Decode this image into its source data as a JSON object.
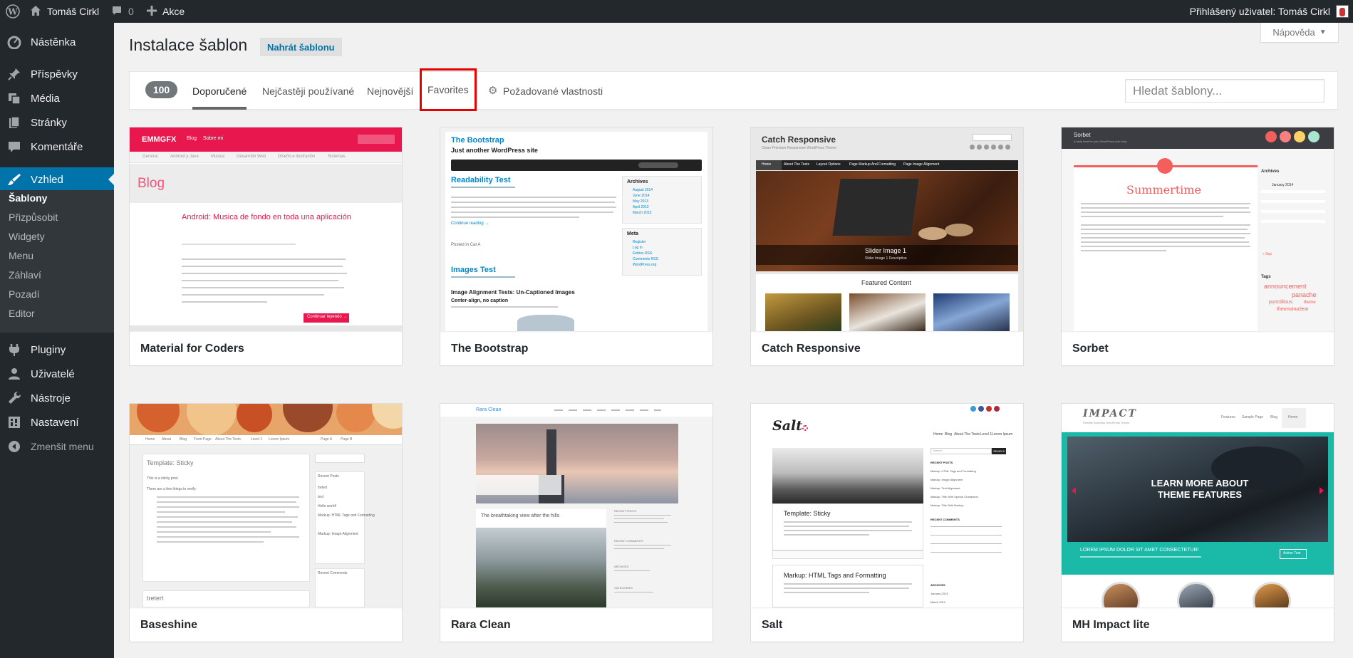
{
  "adminbar": {
    "site_name": "Tomáš Cirkl",
    "comments_count": "0",
    "new_label": "Akce",
    "account_label": "Přihlášený uživatel: Tomáš Cirkl"
  },
  "sidebar": {
    "items": [
      {
        "label": "Nástěnka",
        "icon": "dashboard-icon"
      },
      {
        "label": "Příspěvky",
        "icon": "pin-icon"
      },
      {
        "label": "Média",
        "icon": "media-icon"
      },
      {
        "label": "Stránky",
        "icon": "pages-icon"
      },
      {
        "label": "Komentáře",
        "icon": "comment-icon"
      },
      {
        "label": "Vzhled",
        "icon": "brush-icon"
      },
      {
        "label": "Pluginy",
        "icon": "plugin-icon"
      },
      {
        "label": "Uživatelé",
        "icon": "users-icon"
      },
      {
        "label": "Nástroje",
        "icon": "wrench-icon"
      },
      {
        "label": "Nastavení",
        "icon": "settings-icon"
      }
    ],
    "submenu": [
      "Šablony",
      "Přizpůsobit",
      "Widgety",
      "Menu",
      "Záhlaví",
      "Pozadí",
      "Editor"
    ],
    "collapse_label": "Zmenšit menu"
  },
  "header": {
    "title": "Instalace šablon",
    "upload_label": "Nahrát šablonu",
    "help_label": "Nápověda"
  },
  "filters": {
    "count": "100",
    "tabs": [
      "Doporučené",
      "Nejčastěji používané",
      "Nejnovější",
      "Favorites"
    ],
    "feature_filter": "Požadované vlastnosti",
    "search_placeholder": "Hledat šablony..."
  },
  "themes": [
    {
      "name": "Material for Coders",
      "preview": {
        "logo": "EMMGFX",
        "nav": [
          "Blog",
          "Sobre mi"
        ],
        "cats": [
          "General",
          "Android y Java",
          "Musica",
          "Desarrollo Web",
          "Diseño e ilustración",
          "Sistemas"
        ],
        "heading": "Blog",
        "post_title": "Android: Musica de fondo en toda una aplicación",
        "button": "Continuar leyendo →"
      }
    },
    {
      "name": "The Bootstrap",
      "preview": {
        "site_title": "The Bootstrap",
        "tagline": "Just another WordPress site",
        "post1": "Readability Test",
        "post2": "Images Test",
        "post3": "Image Alignment Tests: Un-Captioned Images",
        "post3_sub": "Center-align, no caption",
        "widget1": "Archives",
        "widget2": "Meta",
        "archives": [
          "August 2014",
          "June 2014",
          "May 2013",
          "April 2013",
          "March 2013"
        ],
        "meta": [
          "Register",
          "Log in",
          "Entries RSS",
          "Comments RSS",
          "WordPress.org"
        ],
        "more": "Continue reading →",
        "posted": "Posted in Cat A"
      }
    },
    {
      "name": "Catch Responsive",
      "preview": {
        "site_title": "Catch Responsive",
        "tagline": "Clean Premium Responsive WordPress Theme",
        "nav": [
          "Home",
          "About The Tests",
          "Layout Options",
          "Page Markup And Formatting",
          "Page Image Alignment"
        ],
        "slider_title": "Slider Image 1",
        "slider_sub": "Slider Image 1 Description",
        "featured": "Featured Content"
      }
    },
    {
      "name": "Sorbet",
      "preview": {
        "site_title": "Sorbet",
        "tagline": "A tasty treat for your WordPress.com blog",
        "post_title": "Summertime",
        "archives": "Archives",
        "calendar": "January 2014",
        "tags_title": "Tags",
        "tags": [
          "announcement",
          "panache",
          "punctilious",
          "theme",
          "thermonuclear"
        ],
        "prev": "« Sep"
      }
    },
    {
      "name": "Baseshine",
      "preview": {
        "nav": [
          "Home",
          "About",
          "Blog",
          "Front Page",
          "About The Tests",
          "Level 1",
          "Lorem Ipsum",
          "Page A",
          "Page B"
        ],
        "post_title": "Template: Sticky",
        "recent": "Recent Posts",
        "recent_items": [
          "tretert",
          "test",
          "Hello world!",
          "Markup: HTML Tags and Formatting",
          "Markup: Image Alignment"
        ],
        "comments": "Recent Comments",
        "post2": "tretert",
        "intro": [
          "This is a sticky post.",
          "There are a few things to verify:"
        ]
      }
    },
    {
      "name": "Rara Clean",
      "preview": {
        "site_title": "Rara Clean",
        "post_title": "The breathtaking view after the hills",
        "widgets": [
          "RECENT POSTS",
          "RECENT COMMENTS",
          "ARCHIVES",
          "CATEGORIES"
        ]
      }
    },
    {
      "name": "Salt",
      "preview": {
        "site_title": "Salt",
        "nav": [
          "Home",
          "Blog",
          "About The Tests",
          "Level 1",
          "Lorem Ipsum"
        ],
        "post_title": "Template: Sticky",
        "post2": "Markup: HTML Tags and Formatting",
        "search": "Search ...",
        "search_btn": "SEARCH",
        "widgets": [
          "RECENT POSTS",
          "RECENT COMMENTS",
          "ARCHIVES"
        ],
        "recent": [
          "Markup: HTML Tags and Formatting",
          "Markup: Image Alignment",
          "Markup: Text Alignment",
          "Markup: Title With Special Characters",
          "Markup: Title With Markup"
        ],
        "archive_items": [
          "January 2013",
          "March 2012"
        ]
      }
    },
    {
      "name": "MH Impact lite",
      "preview": {
        "logo": "IMPACT",
        "logo_sub": "Flexible Business WordPress Theme",
        "nav": [
          "Features",
          "Sample Page",
          "Blog",
          "Home"
        ],
        "slide_title": "LEARN MORE ABOUT THEME FEATURES",
        "banner": "LOREM IPSUM DOLOR SIT AMET CONSECTETUR!",
        "banner_btn": "Action Text"
      }
    }
  ],
  "colors": {
    "admin_bg": "#23282d",
    "accent": "#0073aa",
    "highlight_box": "#e60000",
    "emmgfx_red": "#e8174e",
    "impact_teal": "#1bb9a7"
  }
}
